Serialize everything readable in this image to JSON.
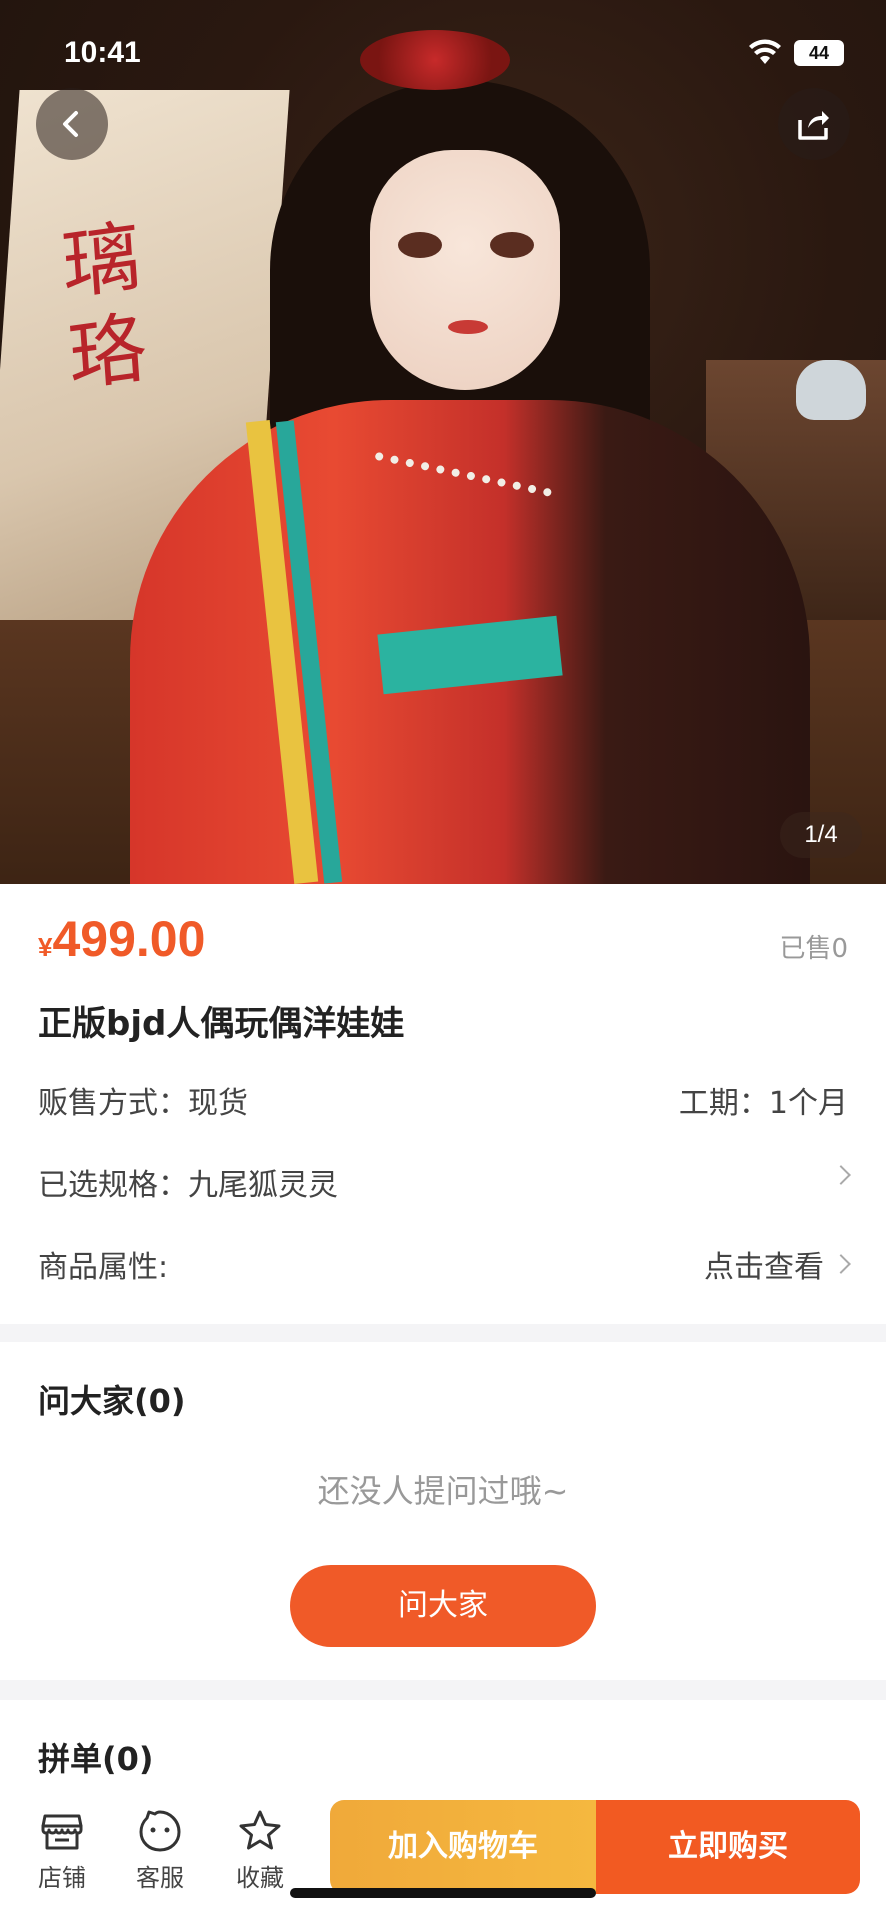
{
  "status": {
    "time": "10:41",
    "battery": "44"
  },
  "hero": {
    "calligraphy": "璃珞",
    "pager": "1/4"
  },
  "product": {
    "price_symbol": "¥",
    "price": "499.00",
    "sold": "已售0",
    "title": "正版bjd人偶玩偶洋娃娃",
    "sale_method_label": "贩售方式：现货",
    "lead_time": "工期：1个月",
    "spec_label": "已选规格：九尾狐灵灵",
    "attr_label": "商品属性:",
    "attr_action": "点击查看"
  },
  "ask": {
    "title": "问大家(0)",
    "empty": "还没人提问过哦~",
    "button": "问大家"
  },
  "group": {
    "title": "拼单(0)"
  },
  "bottom_bar": {
    "store": "店铺",
    "service": "客服",
    "favorite": "收藏",
    "add_to_cart": "加入购物车",
    "buy_now": "立即购买"
  },
  "colors": {
    "accent": "#f05a28",
    "cart": "#f5b83f",
    "buy": "#f25a22"
  }
}
